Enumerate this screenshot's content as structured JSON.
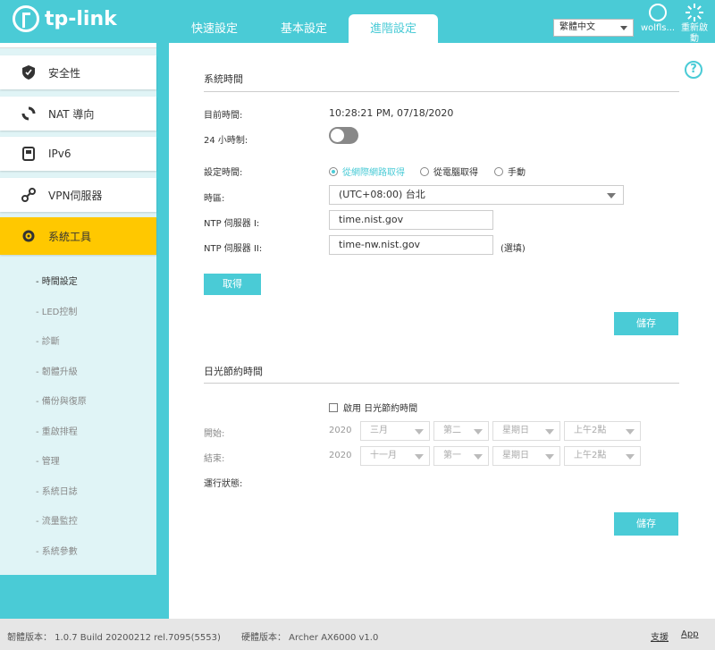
{
  "header": {
    "brand": "tp-link",
    "tabs": [
      {
        "label": "快速設定"
      },
      {
        "label": "基本設定"
      },
      {
        "label": "進階設定"
      }
    ],
    "language": "繁體中文",
    "user_label": "wolfls...",
    "reboot_label": "重新啟動"
  },
  "sidebar": {
    "menu": [
      {
        "label": "安全性",
        "icon": "shield-icon"
      },
      {
        "label": "NAT 導向",
        "icon": "nat-icon"
      },
      {
        "label": "IPv6",
        "icon": "ipv6-icon"
      },
      {
        "label": "VPN伺服器",
        "icon": "vpn-icon"
      },
      {
        "label": "系統工具",
        "icon": "gear-icon"
      }
    ],
    "sub_items": [
      {
        "label": "- 時間設定"
      },
      {
        "label": "- LED控制"
      },
      {
        "label": "- 診斷"
      },
      {
        "label": "- 韌體升級"
      },
      {
        "label": "- 備份與復原"
      },
      {
        "label": "- 重啟排程"
      },
      {
        "label": "- 管理"
      },
      {
        "label": "- 系統日誌"
      },
      {
        "label": "- 流量監控"
      },
      {
        "label": "- 系統參數"
      }
    ]
  },
  "system_time": {
    "title": "系統時間",
    "current_time_label": "目前時間:",
    "current_time_value": "10:28:21 PM, 07/18/2020",
    "hour24_label": "24 小時制:",
    "set_time_label": "設定時間:",
    "radio_options": [
      {
        "label": "從網際網路取得",
        "checked": true
      },
      {
        "label": "從電腦取得",
        "checked": false
      },
      {
        "label": "手動",
        "checked": false
      }
    ],
    "timezone_label": "時區:",
    "timezone_value": "(UTC+08:00) 台北",
    "ntp1_label": "NTP 伺服器 I:",
    "ntp1_value": "time.nist.gov",
    "ntp2_label": "NTP 伺服器 II:",
    "ntp2_value": "time-nw.nist.gov",
    "ntp2_note": "(選填)",
    "obtain_button": "取得",
    "save_button": "儲存"
  },
  "dst": {
    "title": "日光節約時間",
    "enable_label": "啟用 日光節約時間",
    "start_label": "開始:",
    "end_label": "結束:",
    "status_label": "運行狀態:",
    "start": {
      "year": "2020",
      "month": "三月",
      "week": "第二",
      "day": "星期日",
      "time": "上午2點"
    },
    "end": {
      "year": "2020",
      "month": "十一月",
      "week": "第一",
      "day": "星期日",
      "time": "上午2點"
    },
    "save_button": "儲存"
  },
  "footer": {
    "firmware": "韌體版本： 1.0.7 Build 20200212 rel.7095(5553)",
    "hardware": "硬體版本： Archer AX6000 v1.0",
    "support": "支援",
    "app": "App"
  },
  "colors": {
    "accent": "#4acbd6",
    "active_menu": "#ffc800"
  }
}
